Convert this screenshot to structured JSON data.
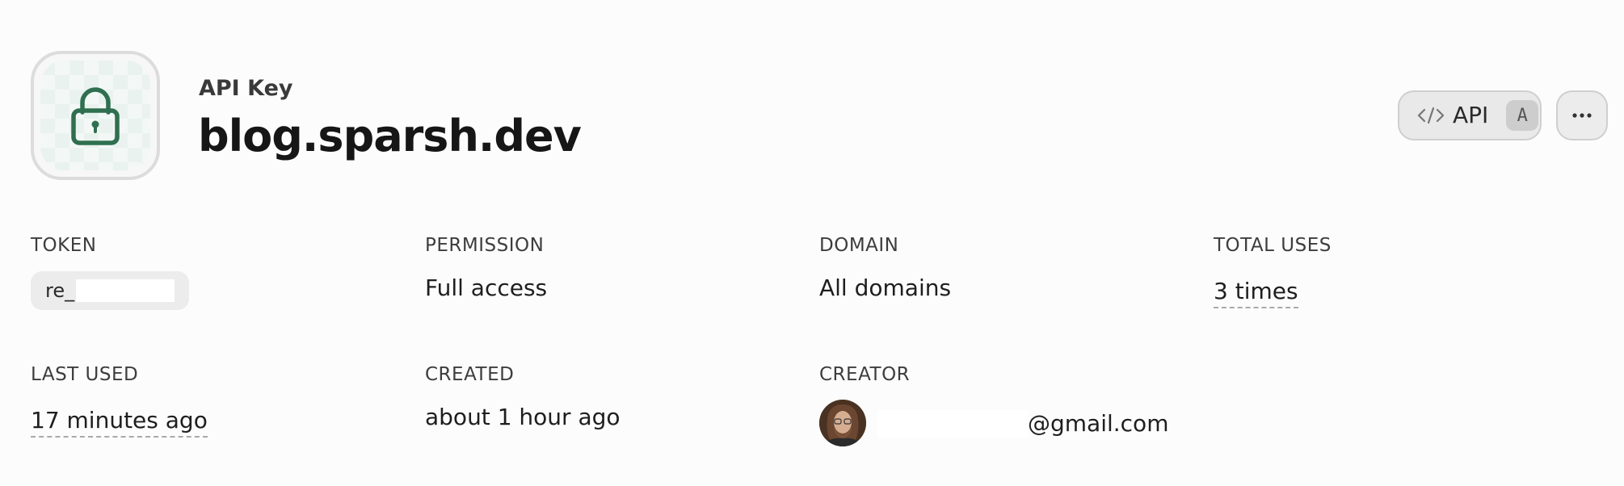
{
  "header": {
    "subtitle": "API Key",
    "title": "blog.sparsh.dev",
    "icon": "lock-icon"
  },
  "actions": {
    "api_label": "API",
    "api_shortcut": "A",
    "api_icon": "code-icon",
    "more_icon": "ellipsis-icon"
  },
  "fields": {
    "token": {
      "label": "TOKEN",
      "value_prefix": "re_"
    },
    "permission": {
      "label": "PERMISSION",
      "value": "Full access"
    },
    "domain": {
      "label": "DOMAIN",
      "value": "All domains"
    },
    "total_uses": {
      "label": "TOTAL USES",
      "value": "3 times"
    },
    "last_used": {
      "label": "LAST USED",
      "value": "17 minutes ago"
    },
    "created": {
      "label": "CREATED",
      "value": "about 1 hour ago"
    },
    "creator": {
      "label": "CREATOR",
      "email_domain": "@gmail.com"
    }
  },
  "colors": {
    "accent_green": "#2f6f4f",
    "background": "#fcfcfc"
  }
}
